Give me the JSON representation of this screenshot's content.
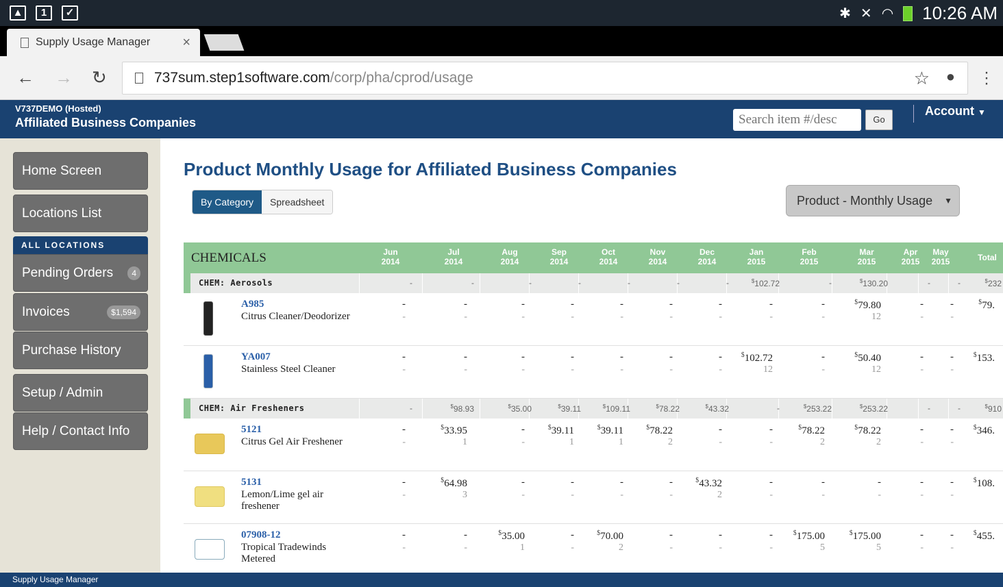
{
  "status_bar": {
    "time": "10:26 AM",
    "calendar_day": "1"
  },
  "browser": {
    "tab_title": "Supply Usage Manager",
    "url_host": "737sum.step1software.com",
    "url_path": "/corp/pha/cprod/usage"
  },
  "header": {
    "account_id": "V737DEMO (Hosted)",
    "company": "Affiliated Business Companies",
    "search_placeholder": "Search item #/desc",
    "go_label": "Go",
    "account_label": "Account"
  },
  "sidebar": {
    "home": "Home Screen",
    "locations": "Locations List",
    "all_locations": "ALL LOCATIONS",
    "pending": "Pending Orders",
    "pending_badge": "4",
    "invoices": "Invoices",
    "invoices_badge": "$1,594",
    "purchase_history": "Purchase History",
    "setup": "Setup / Admin",
    "help": "Help / Contact Info"
  },
  "main": {
    "title": "Product Monthly Usage for Affiliated Business Companies",
    "view_by_category": "By Category",
    "view_spreadsheet": "Spreadsheet",
    "report_select": "Product - Monthly Usage"
  },
  "table": {
    "category": "CHEMICALS",
    "months": [
      [
        "Jun",
        "2014"
      ],
      [
        "Jul",
        "2014"
      ],
      [
        "Aug",
        "2014"
      ],
      [
        "Sep",
        "2014"
      ],
      [
        "Oct",
        "2014"
      ],
      [
        "Nov",
        "2014"
      ],
      [
        "Dec",
        "2014"
      ],
      [
        "Jan",
        "2015"
      ],
      [
        "Feb",
        "2015"
      ],
      [
        "Mar",
        "2015"
      ],
      [
        "Apr",
        "2015"
      ],
      [
        "May",
        "2015"
      ],
      [
        "Total",
        ""
      ]
    ],
    "groups": [
      {
        "name": "CHEM: Aerosols",
        "totals": [
          "-",
          "-",
          "-",
          "-",
          "-",
          "-",
          "-",
          "$102.72",
          "-",
          "$130.20",
          "-",
          "-",
          "$232"
        ],
        "items": [
          {
            "code": "A985",
            "desc": "Citrus Cleaner/Deodorizer",
            "values": [
              "-",
              "-",
              "-",
              "-",
              "-",
              "-",
              "-",
              "-",
              "-",
              "$79.80",
              "-",
              "-",
              "$79."
            ],
            "qty": [
              "-",
              "-",
              "-",
              "-",
              "-",
              "-",
              "-",
              "-",
              "-",
              "12",
              "-",
              "-",
              ""
            ]
          },
          {
            "code": "YA007",
            "desc": "Stainless Steel Cleaner",
            "values": [
              "-",
              "-",
              "-",
              "-",
              "-",
              "-",
              "-",
              "$102.72",
              "-",
              "$50.40",
              "-",
              "-",
              "$153."
            ],
            "qty": [
              "-",
              "-",
              "-",
              "-",
              "-",
              "-",
              "-",
              "12",
              "-",
              "12",
              "-",
              "-",
              ""
            ]
          }
        ]
      },
      {
        "name": "CHEM: Air Fresheners",
        "totals": [
          "-",
          "$98.93",
          "$35.00",
          "$39.11",
          "$109.11",
          "$78.22",
          "$43.32",
          "-",
          "$253.22",
          "$253.22",
          "-",
          "-",
          "$910"
        ],
        "items": [
          {
            "code": "5121",
            "desc": "Citrus Gel Air Freshener",
            "values": [
              "-",
              "$33.95",
              "-",
              "$39.11",
              "$39.11",
              "$78.22",
              "-",
              "-",
              "$78.22",
              "$78.22",
              "-",
              "-",
              "$346."
            ],
            "qty": [
              "-",
              "1",
              "-",
              "1",
              "1",
              "2",
              "-",
              "-",
              "2",
              "2",
              "-",
              "-",
              ""
            ]
          },
          {
            "code": "5131",
            "desc": "Lemon/Lime gel air freshener",
            "values": [
              "-",
              "$64.98",
              "-",
              "-",
              "-",
              "-",
              "$43.32",
              "-",
              "-",
              "-",
              "-",
              "-",
              "$108."
            ],
            "qty": [
              "-",
              "3",
              "-",
              "-",
              "-",
              "-",
              "2",
              "-",
              "-",
              "-",
              "-",
              "-",
              ""
            ]
          },
          {
            "code": "07908-12",
            "desc": "Tropical Tradewinds Metered",
            "values": [
              "-",
              "-",
              "$35.00",
              "-",
              "$70.00",
              "-",
              "-",
              "-",
              "$175.00",
              "$175.00",
              "-",
              "-",
              "$455."
            ],
            "qty": [
              "-",
              "-",
              "1",
              "-",
              "2",
              "-",
              "-",
              "-",
              "5",
              "5",
              "-",
              "-",
              ""
            ]
          }
        ]
      }
    ]
  },
  "footer": {
    "text": "Supply Usage Manager"
  }
}
